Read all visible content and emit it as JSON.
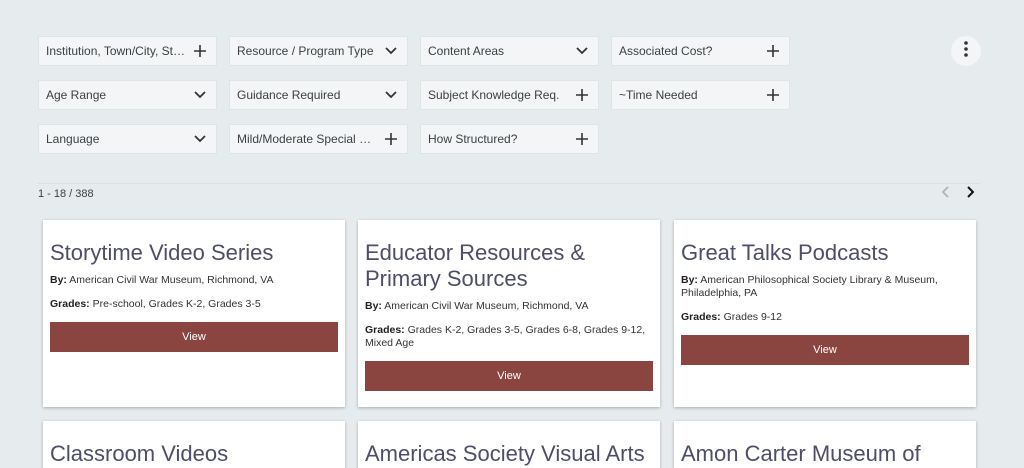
{
  "filters": [
    [
      {
        "label": "Institution, Town/City, Sta…",
        "icon": "plus-icon"
      },
      {
        "label": "Resource / Program Type",
        "icon": "chevron-down-icon"
      },
      {
        "label": "Content Areas",
        "icon": "chevron-down-icon"
      },
      {
        "label": "Associated Cost?",
        "icon": "plus-icon"
      }
    ],
    [
      {
        "label": "Age Range",
        "icon": "chevron-down-icon"
      },
      {
        "label": "Guidance Required",
        "icon": "chevron-down-icon"
      },
      {
        "label": "Subject Knowledge Req.",
        "icon": "plus-icon"
      },
      {
        "label": "~Time Needed",
        "icon": "plus-icon"
      }
    ],
    [
      {
        "label": "Language",
        "icon": "chevron-down-icon"
      },
      {
        "label": "Mild/Moderate Special N…",
        "icon": "plus-icon"
      },
      {
        "label": "How Structured?",
        "icon": "plus-icon"
      }
    ]
  ],
  "pagination": {
    "range_text": "1 - 18 / 388"
  },
  "labels": {
    "by": "By:",
    "grades": "Grades:",
    "view": "View"
  },
  "cards": [
    {
      "title": "Storytime Video Series",
      "by": "American Civil War Museum, Richmond, VA",
      "grades": "Pre-school, Grades K-2, Grades 3-5"
    },
    {
      "title": "Educator Resources & Primary Sources",
      "by": "American Civil War Museum, Richmond, VA",
      "grades": "Grades K-2, Grades 3-5, Grades 6-8, Grades 9-12, Mixed Age"
    },
    {
      "title": "Great Talks Podcasts",
      "by": "American Philosophical Society Library & Museum, Philadelphia, PA",
      "grades": "Grades 9-12"
    },
    {
      "title": "Classroom Videos",
      "by": "",
      "grades": ""
    },
    {
      "title": "Americas Society Visual Arts",
      "by": "",
      "grades": ""
    },
    {
      "title": "Amon Carter Museum of",
      "by": "",
      "grades": ""
    }
  ],
  "colors": {
    "accent": "#8b4540",
    "title": "#4d4d6b",
    "background": "#e6eced"
  }
}
